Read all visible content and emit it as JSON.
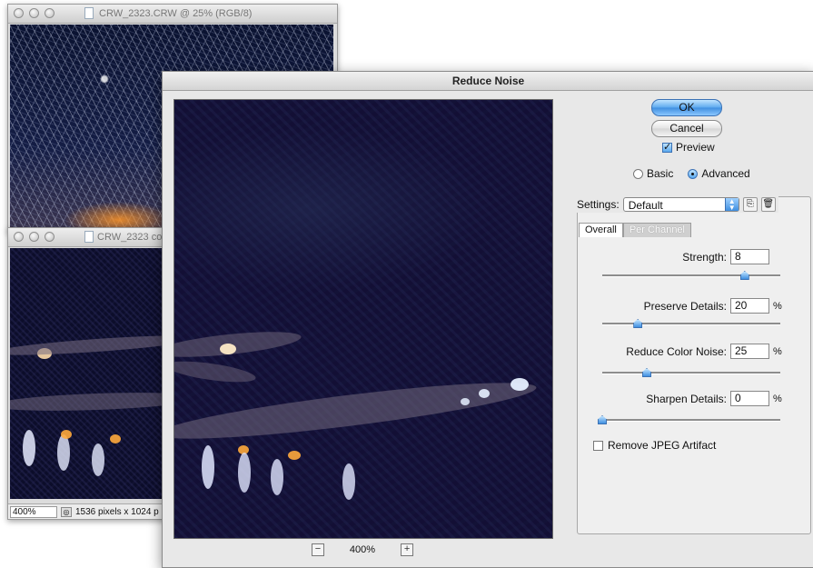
{
  "doc_window_1": {
    "title": "CRW_2323.CRW @ 25% (RGB/8)"
  },
  "doc_window_2": {
    "title": "CRW_2323 co",
    "zoom": "400%",
    "dimensions": "1536 pixels x 1024 p"
  },
  "dialog": {
    "title": "Reduce Noise",
    "ok_label": "OK",
    "cancel_label": "Cancel",
    "preview_label": "Preview",
    "preview_checked": true,
    "mode": {
      "basic_label": "Basic",
      "advanced_label": "Advanced",
      "selected": "Advanced"
    },
    "settings": {
      "label": "Settings:",
      "value": "Default"
    },
    "tabs": [
      {
        "label": "Overall",
        "active": true
      },
      {
        "label": "Per Channel",
        "active": false
      }
    ],
    "controls": {
      "strength": {
        "label": "Strength:",
        "value": "8",
        "unit": "",
        "level": 0.8
      },
      "preserve_details": {
        "label": "Preserve Details:",
        "value": "20",
        "unit": "%",
        "level": 0.2
      },
      "reduce_color_noise": {
        "label": "Reduce Color Noise:",
        "value": "25",
        "unit": "%",
        "level": 0.25
      },
      "sharpen_details": {
        "label": "Sharpen Details:",
        "value": "0",
        "unit": "%",
        "level": 0.0
      }
    },
    "remove_jpeg_label": "Remove JPEG Artifact",
    "remove_jpeg_checked": false,
    "preview_zoom": "400%"
  }
}
